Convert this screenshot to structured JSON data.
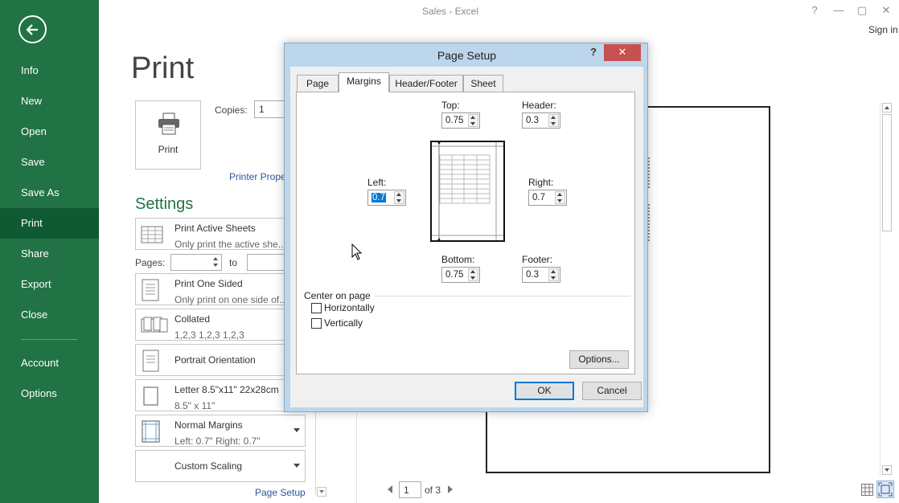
{
  "window": {
    "title": "Sales - Excel",
    "sign_in": "Sign in",
    "controls": {
      "help": "?",
      "minimize": "—",
      "restore": "▢",
      "close": "✕"
    }
  },
  "sidebar": {
    "background": "#217346",
    "active_background": "#0f5a33",
    "back_icon": "back-arrow-icon",
    "items": [
      {
        "label": "Info"
      },
      {
        "label": "New"
      },
      {
        "label": "Open"
      },
      {
        "label": "Save"
      },
      {
        "label": "Save As"
      },
      {
        "label": "Print",
        "active": true
      },
      {
        "label": "Share"
      },
      {
        "label": "Export"
      },
      {
        "label": "Close"
      },
      {
        "label": "Account"
      },
      {
        "label": "Options"
      }
    ]
  },
  "print": {
    "heading": "Print",
    "print_button_label": "Print",
    "copies_label": "Copies:",
    "copies_value": "1",
    "printer_properties_link": "Printer Prope",
    "settings_heading": "Settings",
    "pages_label": "Pages:",
    "pages_to_label": "to",
    "settings": [
      {
        "title": "Print Active Sheets",
        "subtitle": "Only print the active she...",
        "icon": "sheets-icon"
      },
      {
        "title": "Print One Sided",
        "subtitle": "Only print on one side of...",
        "icon": "one-sided-icon"
      },
      {
        "title": "Collated",
        "subtitle": "1,2,3    1,2,3    1,2,3",
        "icon": "collated-icon"
      },
      {
        "title": "Portrait Orientation",
        "subtitle": "",
        "icon": "portrait-icon"
      },
      {
        "title": "Letter 8.5\"x11\" 22x28cm",
        "subtitle": "8.5\" x 11\"",
        "icon": "paper-size-icon"
      },
      {
        "title": "Normal Margins",
        "subtitle": "Left:  0.7\"    Right:  0.7\"",
        "icon": "margins-icon"
      },
      {
        "title": "Custom Scaling",
        "subtitle": "",
        "icon": "scaling-icon"
      }
    ],
    "page_setup_link": "Page Setup",
    "page_nav": {
      "current": "1",
      "of_label": "of 3"
    }
  },
  "dialog": {
    "title": "Page Setup",
    "help": "?",
    "close": "✕",
    "tabs": [
      {
        "label": "Page"
      },
      {
        "label": "Margins",
        "active": true
      },
      {
        "label": "Header/Footer"
      },
      {
        "label": "Sheet"
      }
    ],
    "fields": {
      "top": {
        "label": "Top:",
        "value": "0.75"
      },
      "header": {
        "label": "Header:",
        "value": "0.3"
      },
      "left": {
        "label": "Left:",
        "value": "0.7"
      },
      "right": {
        "label": "Right:",
        "value": "0.7"
      },
      "bottom": {
        "label": "Bottom:",
        "value": "0.75"
      },
      "footer": {
        "label": "Footer:",
        "value": "0.3"
      }
    },
    "center_on_page": {
      "label": "Center on page",
      "horizontally": {
        "label": "Horizontally",
        "checked": false
      },
      "vertically": {
        "label": "Vertically",
        "checked": false
      }
    },
    "options_button": "Options...",
    "ok_button": "OK",
    "cancel_button": "Cancel"
  }
}
